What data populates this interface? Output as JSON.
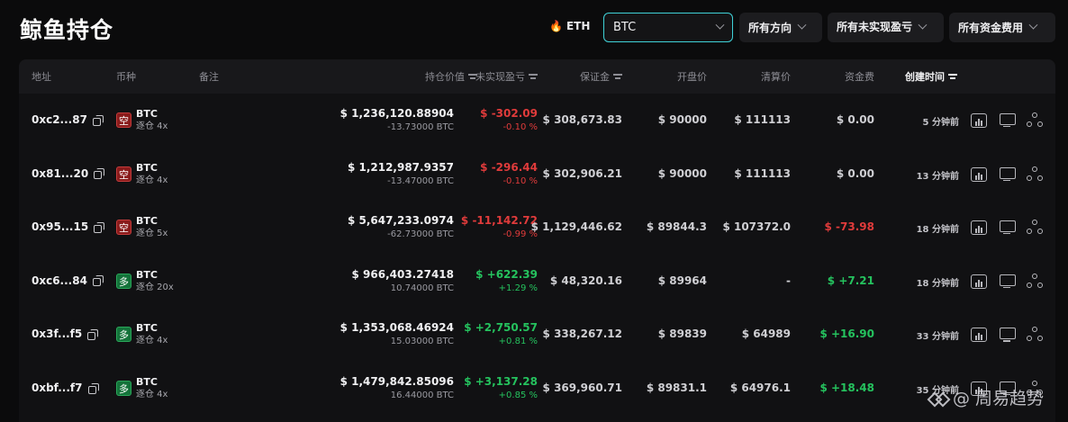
{
  "title": "鲸鱼持仓",
  "filters": {
    "eth_label": "ETH",
    "coin_value": "BTC",
    "direction": "所有方向",
    "unrealized": "所有未实现盈亏",
    "funding": "所有资金费用"
  },
  "columns": {
    "address": "地址",
    "coin": "币种",
    "note": "备注",
    "position_value": "持仓价值",
    "unrealized_pnl": "未实现盈亏",
    "margin": "保证金",
    "open_price": "开盘价",
    "liq_price": "清算价",
    "funding": "资金费",
    "created": "创建时间"
  },
  "rows": [
    {
      "address": "0xc2...87",
      "side": "空",
      "side_type": "short",
      "coin": "BTC",
      "leverage": "逐仓 4x",
      "value": "$ 1,236,120.88904",
      "size": "-13.73000 BTC",
      "pnl": "$ -302.09",
      "pnl_pct": "-0.10 %",
      "pnl_type": "neg",
      "margin": "$ 308,673.83",
      "open": "$ 90000",
      "liq": "$ 111113",
      "funding": "$ 0.00",
      "funding_type": "zero",
      "time": "5 分钟前"
    },
    {
      "address": "0x81...20",
      "side": "空",
      "side_type": "short",
      "coin": "BTC",
      "leverage": "逐仓 4x",
      "value": "$ 1,212,987.9357",
      "size": "-13.47000 BTC",
      "pnl": "$ -296.44",
      "pnl_pct": "-0.10 %",
      "pnl_type": "neg",
      "margin": "$ 302,906.21",
      "open": "$ 90000",
      "liq": "$ 111113",
      "funding": "$ 0.00",
      "funding_type": "zero",
      "time": "13 分钟前"
    },
    {
      "address": "0x95...15",
      "side": "空",
      "side_type": "short",
      "coin": "BTC",
      "leverage": "逐仓 5x",
      "value": "$ 5,647,233.0974",
      "size": "-62.73000 BTC",
      "pnl": "$ -11,142.72",
      "pnl_pct": "-0.99 %",
      "pnl_type": "neg",
      "margin": "$ 1,129,446.62",
      "open": "$ 89844.3",
      "liq": "$ 107372.0",
      "funding": "$ -73.98",
      "funding_type": "neg",
      "time": "18 分钟前"
    },
    {
      "address": "0xc6...84",
      "side": "多",
      "side_type": "long",
      "coin": "BTC",
      "leverage": "逐仓 20x",
      "value": "$ 966,403.27418",
      "size": "10.74000 BTC",
      "pnl": "$ +622.39",
      "pnl_pct": "+1.29 %",
      "pnl_type": "pos",
      "margin": "$ 48,320.16",
      "open": "$ 89964",
      "liq": "-",
      "funding": "$ +7.21",
      "funding_type": "pos",
      "time": "18 分钟前"
    },
    {
      "address": "0x3f...f5",
      "side": "多",
      "side_type": "long",
      "coin": "BTC",
      "leverage": "逐仓 4x",
      "value": "$ 1,353,068.46924",
      "size": "15.03000 BTC",
      "pnl": "$ +2,750.57",
      "pnl_pct": "+0.81 %",
      "pnl_type": "pos",
      "margin": "$ 338,267.12",
      "open": "$ 89839",
      "liq": "$ 64989",
      "funding": "$ +16.90",
      "funding_type": "pos",
      "time": "33 分钟前"
    },
    {
      "address": "0xbf...f7",
      "side": "多",
      "side_type": "long",
      "coin": "BTC",
      "leverage": "逐仓 4x",
      "value": "$ 1,479,842.85096",
      "size": "16.44000 BTC",
      "pnl": "$ +3,137.28",
      "pnl_pct": "+0.85 %",
      "pnl_type": "pos",
      "margin": "$ 369,960.71",
      "open": "$ 89831.1",
      "liq": "$ 64976.1",
      "funding": "$ +18.48",
      "funding_type": "pos",
      "time": "35 分钟前"
    }
  ],
  "watermark": "@ 周易趋势",
  "icons": [
    "flame-icon",
    "chevron-down-icon",
    "sort-filter-icon",
    "copy-icon",
    "chart-icon",
    "monitor-icon",
    "share-icon"
  ],
  "colors": {
    "accent": "#3fd2d8",
    "negative": "#e03b3b",
    "positive": "#25c25e"
  }
}
